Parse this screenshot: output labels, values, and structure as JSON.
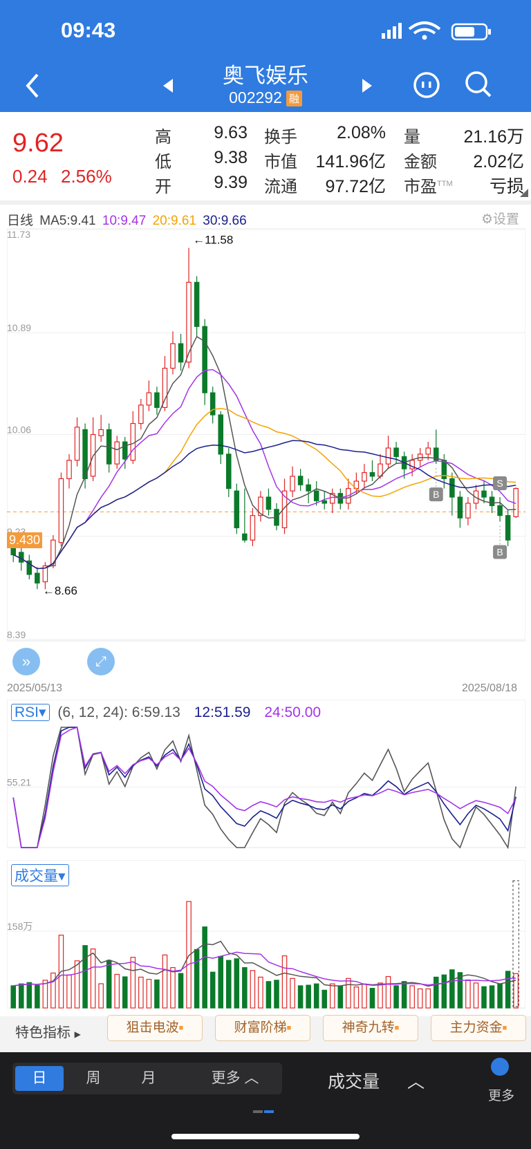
{
  "status": {
    "time": "09:43"
  },
  "header": {
    "name": "奥飞娱乐",
    "code": "002292",
    "badge": "融"
  },
  "quote": {
    "price": "9.62",
    "change": "0.24",
    "change_pct": "2.56%",
    "high_label": "高",
    "high": "9.63",
    "low_label": "低",
    "low": "9.38",
    "open_label": "开",
    "open": "9.39",
    "turnover_label": "换手",
    "turnover": "2.08%",
    "mktcap_label": "市值",
    "mktcap": "141.96亿",
    "float_label": "流通",
    "float": "97.72亿",
    "vol_label": "量",
    "vol": "21.16万",
    "amount_label": "金额",
    "amount": "2.02亿",
    "pe_label": "市盈",
    "pe_sup": "TTM",
    "pe": "亏损"
  },
  "chart_header": {
    "period": "日线",
    "ma5": "MA5:9.41",
    "ma10": "10:9.47",
    "ma20": "20:9.61",
    "ma30": "30:9.66",
    "settings": "设置"
  },
  "colors": {
    "up": "#e02424",
    "down": "#0b7a2a",
    "ma5": "#555555",
    "ma10": "#a433e8",
    "ma20": "#f4a300",
    "ma30": "#1a1f8c",
    "header": "#2f7be0"
  },
  "chart_data": {
    "type": "candlestick",
    "y_ticks": [
      "11.73",
      "10.89",
      "10.06",
      "9.23",
      "8.39"
    ],
    "ylim": [
      8.39,
      11.73
    ],
    "date_start": "2025/05/13",
    "date_end": "2025/08/18",
    "current_line": "9.430",
    "max_label": "←11.58",
    "min_label": "←8.66",
    "signals": [
      "B",
      "S",
      "B"
    ],
    "candles": [
      [
        9.15,
        9.08,
        9.2,
        9.02
      ],
      [
        9.1,
        9.02,
        9.15,
        8.95
      ],
      [
        9.03,
        8.92,
        9.08,
        8.88
      ],
      [
        8.93,
        8.85,
        8.98,
        8.8
      ],
      [
        8.86,
        8.99,
        9.02,
        8.8
      ],
      [
        8.99,
        9.2,
        9.24,
        8.97
      ],
      [
        9.18,
        9.7,
        9.75,
        9.15
      ],
      [
        9.7,
        9.85,
        9.9,
        9.62
      ],
      [
        9.85,
        10.12,
        10.2,
        9.8
      ],
      [
        10.1,
        9.7,
        10.15,
        9.62
      ],
      [
        9.72,
        10.06,
        10.2,
        9.68
      ],
      [
        10.05,
        10.1,
        10.22,
        10.0
      ],
      [
        10.1,
        9.82,
        10.15,
        9.75
      ],
      [
        9.82,
        10.0,
        10.05,
        9.78
      ],
      [
        10.0,
        9.86,
        10.04,
        9.78
      ],
      [
        9.85,
        10.15,
        10.25,
        9.82
      ],
      [
        10.15,
        10.3,
        10.35,
        10.1
      ],
      [
        10.3,
        10.4,
        10.5,
        10.25
      ],
      [
        10.4,
        10.28,
        10.45,
        10.22
      ],
      [
        10.28,
        10.6,
        10.7,
        10.25
      ],
      [
        10.6,
        10.8,
        10.9,
        10.55
      ],
      [
        10.8,
        10.65,
        10.88,
        10.58
      ],
      [
        10.65,
        11.3,
        11.58,
        10.6
      ],
      [
        11.3,
        10.94,
        11.35,
        10.85
      ],
      [
        10.94,
        10.4,
        11.0,
        10.3
      ],
      [
        10.4,
        10.22,
        10.45,
        10.15
      ],
      [
        10.22,
        9.9,
        10.25,
        9.82
      ],
      [
        9.9,
        9.62,
        9.95,
        9.55
      ],
      [
        9.6,
        9.3,
        9.66,
        9.25
      ],
      [
        9.25,
        9.2,
        9.62,
        9.18
      ],
      [
        9.2,
        9.4,
        9.46,
        9.15
      ],
      [
        9.4,
        9.55,
        9.6,
        9.35
      ],
      [
        9.55,
        9.45,
        9.62,
        9.4
      ],
      [
        9.45,
        9.32,
        9.5,
        9.28
      ],
      [
        9.3,
        9.6,
        9.7,
        9.25
      ],
      [
        9.6,
        9.72,
        9.8,
        9.55
      ],
      [
        9.72,
        9.65,
        9.78,
        9.6
      ],
      [
        9.65,
        9.6,
        9.7,
        9.5
      ],
      [
        9.6,
        9.52,
        9.68,
        9.48
      ],
      [
        9.52,
        9.5,
        9.6,
        9.45
      ],
      [
        9.5,
        9.58,
        9.62,
        9.42
      ],
      [
        9.58,
        9.5,
        9.62,
        9.45
      ],
      [
        9.5,
        9.62,
        9.7,
        9.45
      ],
      [
        9.62,
        9.68,
        9.75,
        9.58
      ],
      [
        9.68,
        9.75,
        9.82,
        9.62
      ],
      [
        9.75,
        9.72,
        9.85,
        9.68
      ],
      [
        9.72,
        9.82,
        9.9,
        9.7
      ],
      [
        9.82,
        9.95,
        10.05,
        9.78
      ],
      [
        9.95,
        9.88,
        10.0,
        9.82
      ],
      [
        9.88,
        9.78,
        9.92,
        9.7
      ],
      [
        9.78,
        9.85,
        9.9,
        9.72
      ],
      [
        9.85,
        9.9,
        9.95,
        9.8
      ],
      [
        9.9,
        9.95,
        10.0,
        9.85
      ],
      [
        9.95,
        9.85,
        10.1,
        9.82
      ],
      [
        9.85,
        9.7,
        9.9,
        9.62
      ],
      [
        9.7,
        9.55,
        9.75,
        9.4
      ],
      [
        9.55,
        9.38,
        9.6,
        9.3
      ],
      [
        9.38,
        9.5,
        9.55,
        9.32
      ],
      [
        9.5,
        9.6,
        9.65,
        9.45
      ],
      [
        9.6,
        9.55,
        9.68,
        9.5
      ],
      [
        9.55,
        9.48,
        9.6,
        9.42
      ],
      [
        9.48,
        9.4,
        9.55,
        9.35
      ],
      [
        9.4,
        9.2,
        9.45,
        9.15
      ],
      [
        9.39,
        9.62,
        9.63,
        9.38
      ]
    ]
  },
  "rsi": {
    "label": "RSI",
    "params": "(6, 12, 24): 6:59.13",
    "rsi12": "12:51.59",
    "rsi24": "24:50.00",
    "level": "55.21"
  },
  "volume": {
    "label": "成交量",
    "tick": "158万"
  },
  "indicators": {
    "label": "特色指标",
    "tabs": [
      "狙击电波",
      "财富阶梯",
      "神奇九转",
      "主力资金"
    ]
  },
  "bottom": {
    "periods": [
      "日",
      "周",
      "月",
      "更多"
    ],
    "indicator": "成交量",
    "more": "更多"
  }
}
